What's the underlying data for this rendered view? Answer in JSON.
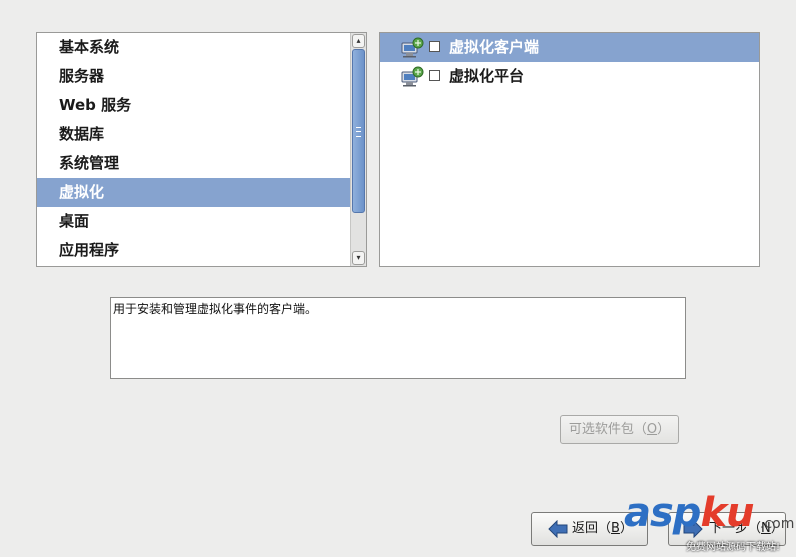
{
  "categories": {
    "items": [
      {
        "label": "基本系统",
        "selected": false
      },
      {
        "label": "服务器",
        "selected": false
      },
      {
        "label": "Web 服务",
        "selected": false
      },
      {
        "label": "数据库",
        "selected": false
      },
      {
        "label": "系统管理",
        "selected": false
      },
      {
        "label": "虚拟化",
        "selected": true
      },
      {
        "label": "桌面",
        "selected": false
      },
      {
        "label": "应用程序",
        "selected": false
      }
    ]
  },
  "packages": {
    "items": [
      {
        "label": "虚拟化客户端",
        "checked": false,
        "selected": true,
        "icon": "package-group-icon"
      },
      {
        "label": "虚拟化平台",
        "checked": false,
        "selected": false,
        "icon": "package-group-icon"
      }
    ]
  },
  "description": {
    "text": "用于安装和管理虚拟化事件的客户端。"
  },
  "buttons": {
    "optional": {
      "label_prefix": "可选软件包（",
      "mnemonic": "O",
      "label_suffix": "）",
      "enabled": false
    },
    "back": {
      "label_prefix": "返回（",
      "mnemonic": "B",
      "label_suffix": "）"
    },
    "next": {
      "label_prefix": "下一步（",
      "mnemonic": "N",
      "label_suffix": "）"
    }
  },
  "watermark": {
    "logo_part1": "asp",
    "logo_part2": "ku",
    "tld": ".com",
    "subtitle": "免费网站源码下载站!"
  },
  "colors": {
    "selection": "#86a3cf",
    "background": "#ededec",
    "scroll_thumb": "#6c92c9"
  }
}
